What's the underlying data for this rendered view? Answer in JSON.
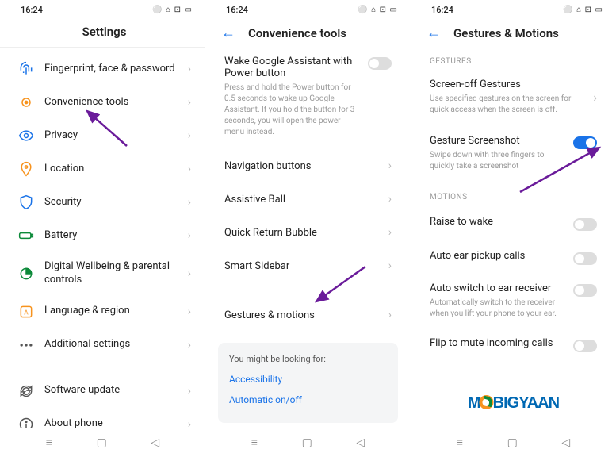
{
  "status": {
    "time": "16:24",
    "icons": "⚪ ⌂ ⊡ ▭"
  },
  "screen1": {
    "title": "Settings",
    "items": [
      {
        "label": "Fingerprint, face & password"
      },
      {
        "label": "Convenience tools"
      },
      {
        "label": "Privacy"
      },
      {
        "label": "Location"
      },
      {
        "label": "Security"
      },
      {
        "label": "Battery"
      },
      {
        "label": "Digital Wellbeing & parental controls"
      },
      {
        "label": "Language & region"
      },
      {
        "label": "Additional settings"
      },
      {
        "label": "Software update"
      },
      {
        "label": "About phone"
      }
    ]
  },
  "screen2": {
    "title": "Convenience tools",
    "wake": {
      "title": "Wake Google Assistant with Power button",
      "desc": "Press and hold the Power button for 0.5 seconds to wake up Google Assistant. If you hold the button for 3 seconds, you will open the power menu instead."
    },
    "rows": [
      "Navigation buttons",
      "Assistive Ball",
      "Quick Return Bubble",
      "Smart Sidebar",
      "Gestures & motions"
    ],
    "suggest": {
      "head": "You might be looking for:",
      "links": [
        "Accessibility",
        "Automatic on/off"
      ]
    }
  },
  "screen3": {
    "title": "Gestures & Motions",
    "sec1": "GESTURES",
    "sog": {
      "title": "Screen-off Gestures",
      "desc": "Use specified gestures on the screen for quick access when the screen is off."
    },
    "gss": {
      "title": "Gesture Screenshot",
      "desc": "Swipe down with three fingers to quickly take a screenshot"
    },
    "sec2": "MOTIONS",
    "motions": [
      {
        "label": "Raise to wake"
      },
      {
        "label": "Auto ear pickup calls"
      },
      {
        "label": "Auto switch to ear receiver",
        "desc": "Automatically switch to the receiver when you lift your phone to your ear."
      },
      {
        "label": "Flip to mute incoming calls"
      }
    ]
  }
}
